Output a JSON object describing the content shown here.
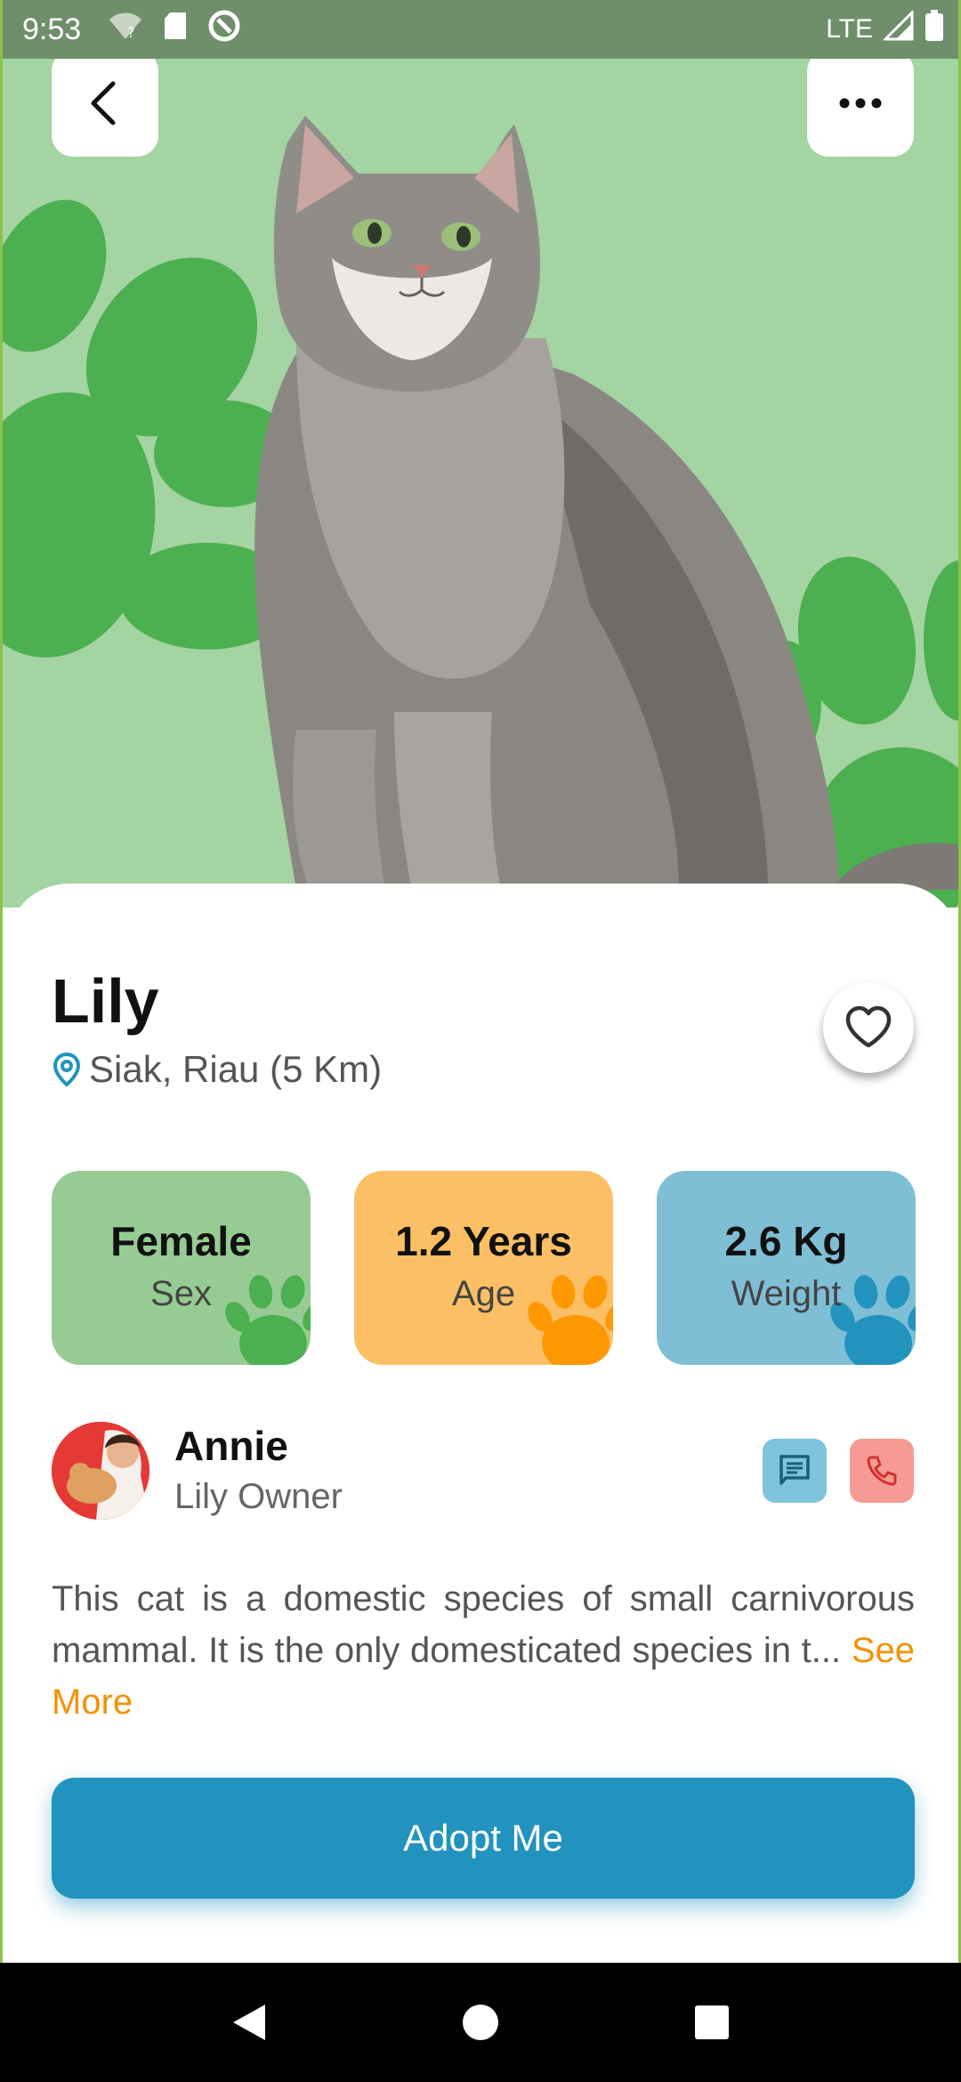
{
  "status_bar": {
    "time": "9:53",
    "network": "LTE",
    "icons": [
      "wifi-question-icon",
      "sd-card-icon",
      "sync-circle-icon",
      "signal-icon",
      "battery-icon"
    ]
  },
  "header": {
    "back_icon": "chevron-left-icon",
    "more_icon": "more-horizontal-icon"
  },
  "pet": {
    "name": "Lily",
    "location": "Siak, Riau (5 Km)",
    "favorite_icon": "heart-outline-icon"
  },
  "stats": [
    {
      "value": "Female",
      "label": "Sex",
      "color": "#96cc94",
      "paw_color": "#4caf50"
    },
    {
      "value": "1.2 Years",
      "label": "Age",
      "color": "#fdbf65",
      "paw_color": "#ff9800"
    },
    {
      "value": "2.6 Kg",
      "label": "Weight",
      "color": "#7fbfd6",
      "paw_color": "#2293bf"
    }
  ],
  "owner": {
    "name": "Annie",
    "role": "Lily Owner",
    "chat_icon": "message-icon",
    "call_icon": "phone-icon"
  },
  "description": {
    "text": "This cat is a domestic species of small carnivorous mammal. It is the only domesticated species in t...",
    "see_more": " See More"
  },
  "actions": {
    "adopt_label": "Adopt Me"
  },
  "colors": {
    "hero_bg": "#a3d4a1",
    "paw_green": "#4caf50",
    "accent_blue": "#2293bf",
    "accent_orange": "#f39200"
  }
}
